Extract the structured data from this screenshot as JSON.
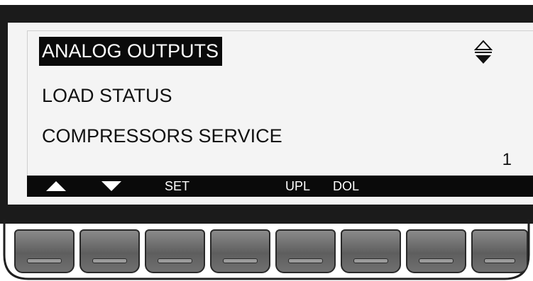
{
  "menu": {
    "items": [
      {
        "label": "ANALOG OUTPUTS",
        "selected": true
      },
      {
        "label": "LOAD STATUS",
        "selected": false
      },
      {
        "label": "COMPRESSORS SERVICE",
        "selected": false
      }
    ],
    "scroll_indicator_icon": "up-down-arrow-icon",
    "page_number": "1"
  },
  "softkeys": {
    "up_icon": "up-triangle-icon",
    "down_icon": "down-triangle-icon",
    "set": "SET",
    "upl": "UPL",
    "dol": "DOL"
  },
  "colors": {
    "bezel": "#1b1b1b",
    "screen": "#f4f4f4",
    "highlight": "#0a0a0a",
    "key": "#6e6e6e"
  }
}
